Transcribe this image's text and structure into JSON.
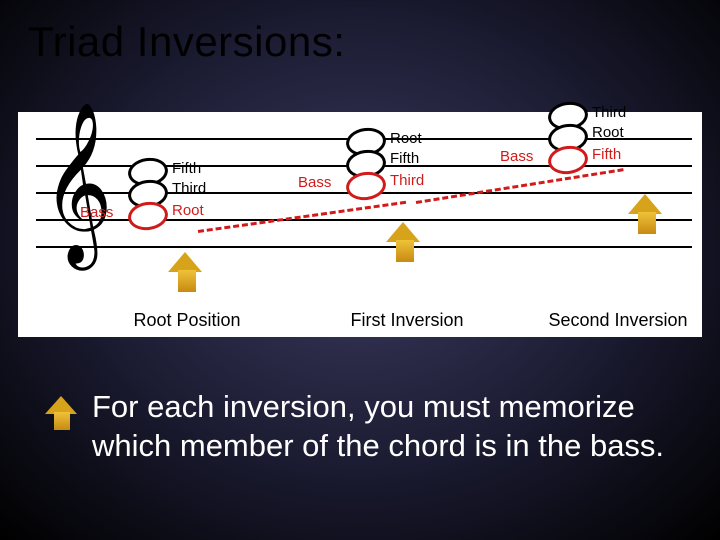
{
  "title": "Triad Inversions:",
  "figure": {
    "bass_label": "Bass",
    "chords": [
      {
        "name": "Root Position",
        "notes": [
          {
            "label": "Fifth",
            "is_bass": false
          },
          {
            "label": "Third",
            "is_bass": false
          },
          {
            "label": "Root",
            "is_bass": true
          }
        ]
      },
      {
        "name": "First Inversion",
        "notes": [
          {
            "label": "Root",
            "is_bass": false
          },
          {
            "label": "Fifth",
            "is_bass": false
          },
          {
            "label": "Third",
            "is_bass": true
          }
        ]
      },
      {
        "name": "Second Inversion",
        "notes": [
          {
            "label": "Third",
            "is_bass": false
          },
          {
            "label": "Root",
            "is_bass": false
          },
          {
            "label": "Fifth",
            "is_bass": true
          }
        ]
      }
    ]
  },
  "body": "For each inversion, you must memorize which member of the chord is in the bass."
}
